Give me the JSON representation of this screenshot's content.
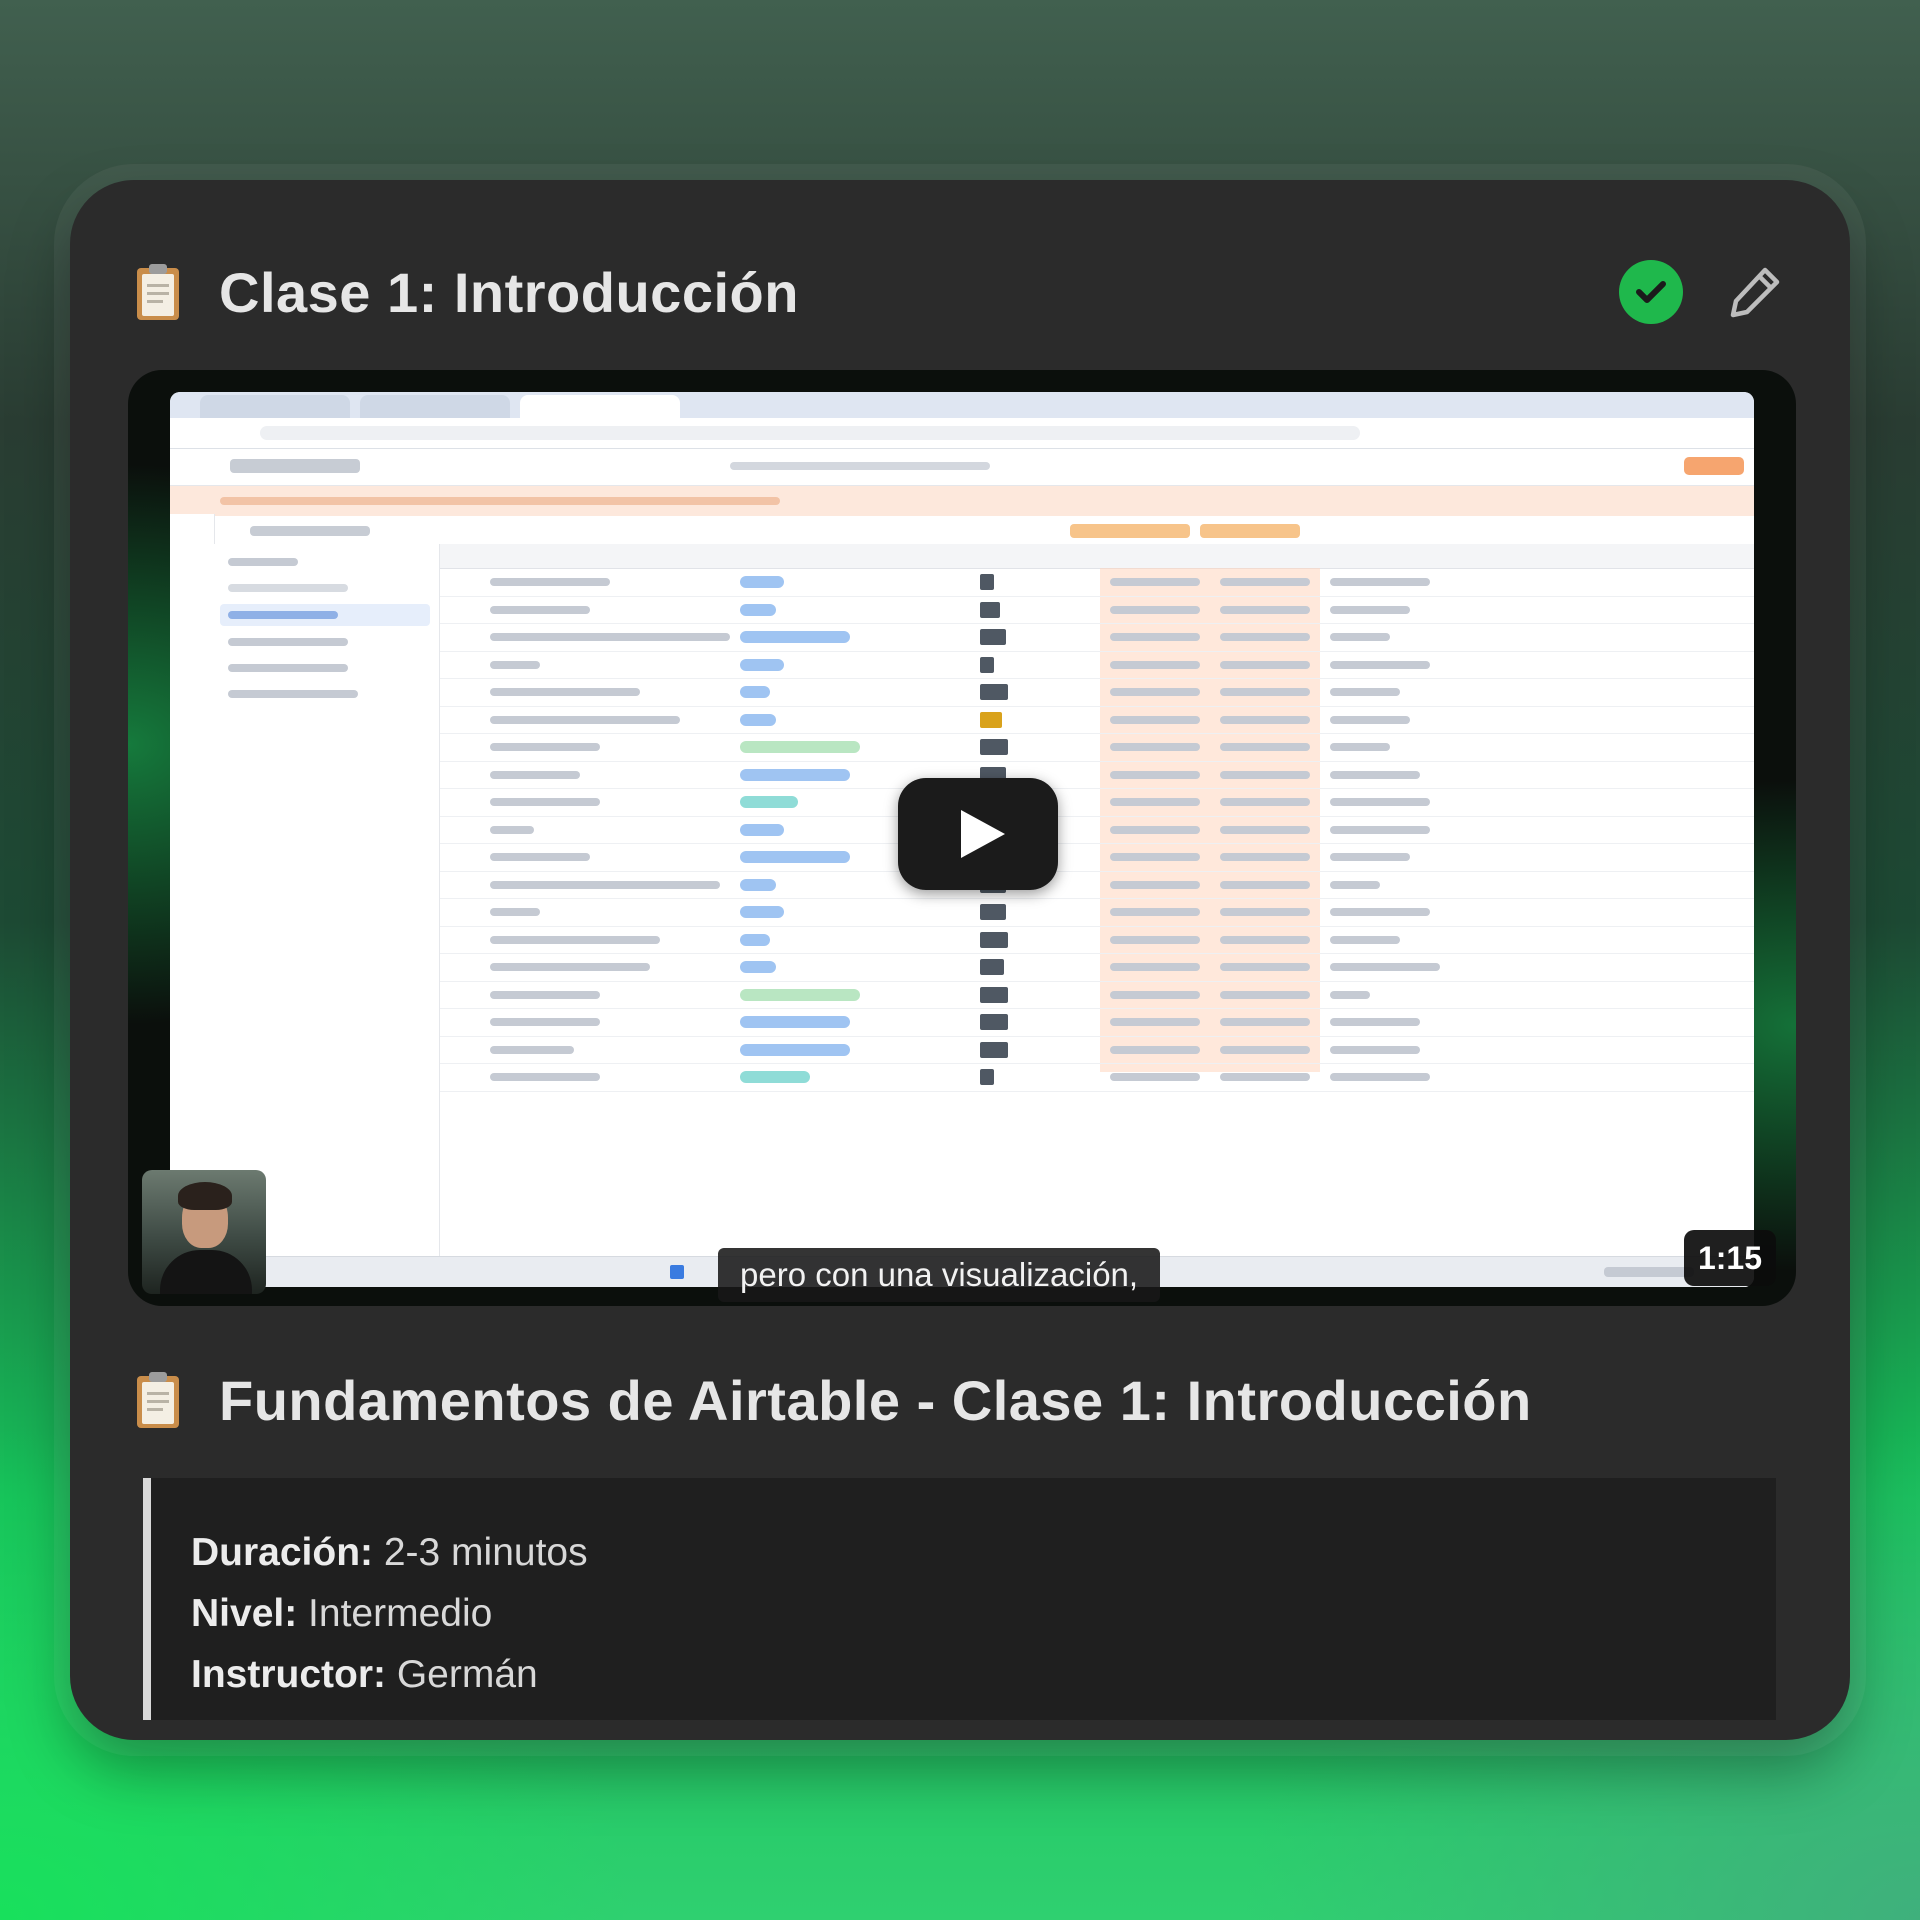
{
  "header": {
    "icon": "clipboard-icon",
    "title": "Clase 1: Introducción",
    "status_icon": "check-circle-icon",
    "edit_icon": "pencil-icon",
    "status_color": "#1fb84c"
  },
  "video": {
    "play_icon": "play-icon",
    "subtitle": "pero con una visualización,",
    "duration": "1:15"
  },
  "section": {
    "icon": "clipboard-icon",
    "title": "Fundamentos de Airtable - Clase 1: Introducción"
  },
  "details": {
    "duration_label": "Duración:",
    "duration_value": "2-3 minutos",
    "level_label": "Nivel:",
    "level_value": "Intermedio",
    "instructor_label": "Instructor:",
    "instructor_value": "Germán"
  },
  "colors": {
    "card_background": "#2b2b2b",
    "accent_green": "#1fb84c",
    "quote_background": "#1f1f1f"
  }
}
